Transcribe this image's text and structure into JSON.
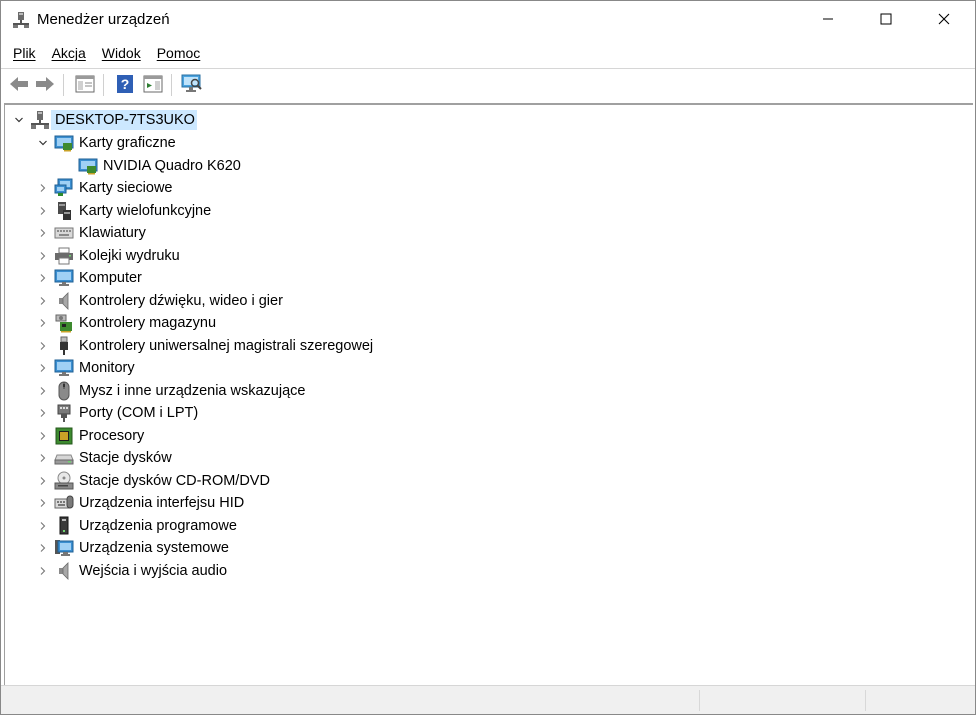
{
  "window": {
    "title": "Menedżer urządzeń",
    "icon": "device-manager-icon",
    "controls": [
      "minimize-icon",
      "maximize-icon",
      "close-icon"
    ]
  },
  "menu": {
    "items": [
      {
        "label": "Plik"
      },
      {
        "label": "Akcja"
      },
      {
        "label": "Widok"
      },
      {
        "label": "Pomoc"
      }
    ]
  },
  "toolbar": {
    "buttons": [
      "back-arrow-icon",
      "forward-arrow-icon",
      "properties-icon",
      "help-icon",
      "show-hide-pane-icon",
      "scan-hardware-icon"
    ]
  },
  "tree": {
    "root": {
      "label": "DESKTOP-7TS3UKO",
      "icon": "computer-tower-icon",
      "expanded": true,
      "selected": true
    },
    "categories": [
      {
        "label": "Karty graficzne",
        "icon": "display-adapter-icon",
        "expanded": true,
        "children": [
          {
            "label": "NVIDIA Quadro K620",
            "icon": "display-adapter-icon"
          }
        ]
      },
      {
        "label": "Karty sieciowe",
        "icon": "network-adapter-icon"
      },
      {
        "label": "Karty wielofunkcyjne",
        "icon": "multifunction-card-icon"
      },
      {
        "label": "Klawiatury",
        "icon": "keyboard-icon"
      },
      {
        "label": "Kolejki wydruku",
        "icon": "printer-icon"
      },
      {
        "label": "Komputer",
        "icon": "monitor-icon"
      },
      {
        "label": "Kontrolery dźwięku, wideo i gier",
        "icon": "speaker-icon"
      },
      {
        "label": "Kontrolery magazynu",
        "icon": "storage-controller-icon"
      },
      {
        "label": "Kontrolery uniwersalnej magistrali szeregowej",
        "icon": "usb-plug-icon"
      },
      {
        "label": "Monitory",
        "icon": "monitor-icon"
      },
      {
        "label": "Mysz i inne urządzenia wskazujące",
        "icon": "mouse-icon"
      },
      {
        "label": "Porty (COM i LPT)",
        "icon": "port-icon"
      },
      {
        "label": "Procesory",
        "icon": "processor-chip-icon"
      },
      {
        "label": "Stacje dysków",
        "icon": "disk-drive-icon"
      },
      {
        "label": "Stacje dysków CD-ROM/DVD",
        "icon": "cd-rom-icon"
      },
      {
        "label": "Urządzenia interfejsu HID",
        "icon": "hid-icon"
      },
      {
        "label": "Urządzenia programowe",
        "icon": "software-device-icon"
      },
      {
        "label": "Urządzenia systemowe",
        "icon": "system-devices-icon"
      },
      {
        "label": "Wejścia i wyjścia audio",
        "icon": "speaker-icon"
      }
    ]
  }
}
